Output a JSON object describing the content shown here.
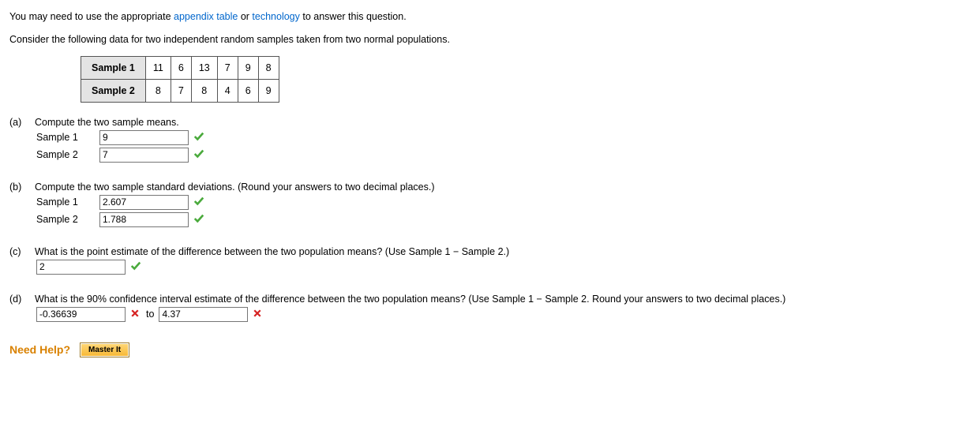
{
  "intro": {
    "pre": "You may need to use the appropriate ",
    "link1": "appendix table",
    "mid": " or ",
    "link2": "technology",
    "post": " to answer this question."
  },
  "description": "Consider the following data for two independent random samples taken from two normal populations.",
  "table": {
    "row1_label": "Sample 1",
    "row1_values": [
      "11",
      "6",
      "13",
      "7",
      "9",
      "8"
    ],
    "row2_label": "Sample 2",
    "row2_values": [
      "8",
      "7",
      "8",
      "4",
      "6",
      "9"
    ]
  },
  "parts": {
    "a": {
      "letter": "(a)",
      "text": "Compute the two sample means.",
      "s1_label": "Sample 1",
      "s1_value": "9",
      "s2_label": "Sample 2",
      "s2_value": "7"
    },
    "b": {
      "letter": "(b)",
      "text": "Compute the two sample standard deviations. (Round your answers to two decimal places.)",
      "s1_label": "Sample 1",
      "s1_value": "2.607",
      "s2_label": "Sample 2",
      "s2_value": "1.788"
    },
    "c": {
      "letter": "(c)",
      "text": "What is the point estimate of the difference between the two population means? (Use Sample 1 − Sample 2.)",
      "value": "2"
    },
    "d": {
      "letter": "(d)",
      "text": "What is the 90% confidence interval estimate of the difference between the two population means? (Use Sample 1 − Sample 2. Round your answers to two decimal places.)",
      "lower": "-0.36639",
      "to": "to",
      "upper": "4.37"
    }
  },
  "help": {
    "label": "Need Help?",
    "button": "Master It"
  }
}
